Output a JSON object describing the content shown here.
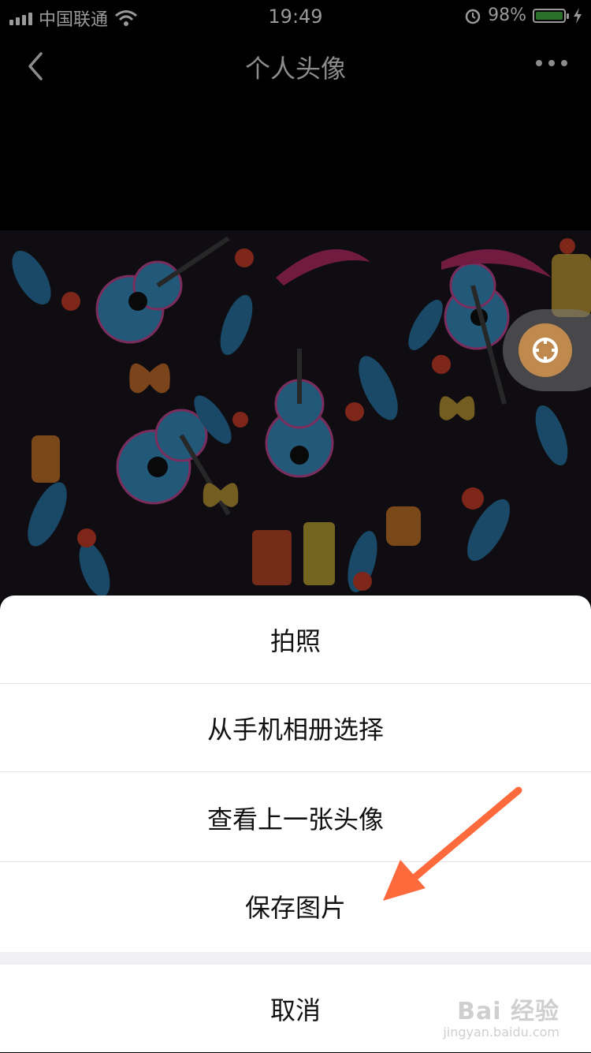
{
  "status_bar": {
    "carrier": "中国联通",
    "time": "19:49",
    "battery": "98%",
    "battery_level": 0.98
  },
  "nav": {
    "title": "个人头像",
    "back_icon": "chevron-left-icon",
    "more_icon": "more-dots-icon"
  },
  "action_sheet": {
    "items": [
      "拍照",
      "从手机相册选择",
      "查看上一张头像",
      "保存图片"
    ],
    "cancel": "取消"
  },
  "annotation": {
    "arrow_color": "#ff6a3d"
  },
  "watermark": {
    "logo": "Bai 经验",
    "url": "jingyan.baidu.com"
  }
}
